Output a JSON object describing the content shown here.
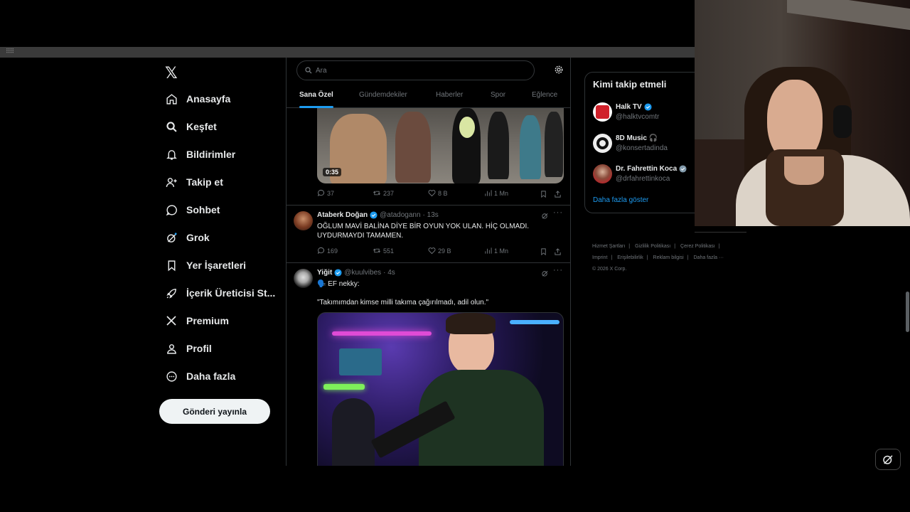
{
  "topbar": {
    "grid_icon": "grid-icon"
  },
  "nav": {
    "logo": "𝕏",
    "items": [
      {
        "label": "Anasayfa",
        "icon": "home-icon"
      },
      {
        "label": "Keşfet",
        "icon": "search-icon"
      },
      {
        "label": "Bildirimler",
        "icon": "bell-icon"
      },
      {
        "label": "Takip et",
        "icon": "add-person-icon"
      },
      {
        "label": "Sohbet",
        "icon": "chat-bubble-icon"
      },
      {
        "label": "Grok",
        "icon": "grok-icon"
      },
      {
        "label": "Yer İşaretleri",
        "icon": "bookmark-icon"
      },
      {
        "label": "İçerik Üreticisi St...",
        "icon": "rocket-icon"
      },
      {
        "label": "Premium",
        "icon": "x-logo-icon"
      },
      {
        "label": "Profil",
        "icon": "person-icon"
      },
      {
        "label": "Daha fazla",
        "icon": "more-circle-icon"
      }
    ],
    "post_button": "Gönderi yayınla"
  },
  "search": {
    "placeholder": "Ara"
  },
  "tabs": [
    "Sana Özel",
    "Gündemdekiler",
    "Haberler",
    "Spor",
    "Eğlence"
  ],
  "feed": {
    "tweet0": {
      "duration": "0:35",
      "replies": "37",
      "reposts": "237",
      "likes": "8 B",
      "views": "1 Mn"
    },
    "tweet1": {
      "name": "Ataberk Doğan",
      "handle": "@atadogann",
      "time": "· 13s",
      "text": "OĞLUM MAVİ BALİNA DİYE BİR OYUN YOK ULAN. HİÇ OLMADI. UYDURMAYDI TAMAMEN.",
      "replies": "169",
      "reposts": "551",
      "likes": "29 B",
      "views": "1 Mn"
    },
    "tweet2": {
      "name": "Yiğit",
      "handle": "@kuulvibes",
      "time": "· 4s",
      "line1": "🗣️ EF nekky:",
      "line2": "\"Takımımdan kimse milli takıma çağırılmadı, adil olun.\""
    }
  },
  "who_to_follow": {
    "title": "Kimi takip etmeli",
    "accounts": [
      {
        "name": "Halk TV",
        "handle": "@halktvcomtr",
        "verified": true
      },
      {
        "name": "8D Music 🎧",
        "handle": "@konsertadinda",
        "verified": false
      },
      {
        "name": "Dr. Fahrettin Koca",
        "handle": "@drfahrettinkoca",
        "verified": true
      }
    ],
    "show_more": "Daha fazla göster"
  },
  "footer": {
    "links": [
      "Hizmet Şartları",
      "Gizlilik Politikası",
      "Çerez Politikası",
      "Imprint",
      "Erişilebilirlik",
      "Reklam bilgisi",
      "Daha fazla ···"
    ],
    "copyright": "© 2026 X Corp."
  },
  "colors": {
    "accent": "#1d9bf0",
    "bg": "#000000",
    "border": "#2f3336",
    "muted": "#71767b"
  }
}
